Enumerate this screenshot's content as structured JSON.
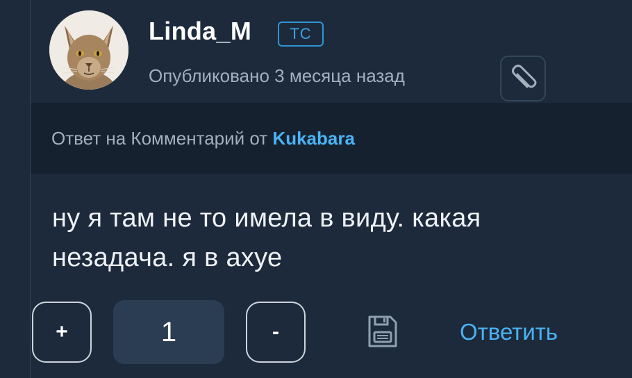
{
  "comment": {
    "username": "Linda_M",
    "badge": "ТС",
    "published": "Опубликовано 3 месяца назад",
    "reply_prefix": "Ответ на Комментарий от",
    "reply_author": "Kukabara",
    "text": "ну я там не то имела в виду. какая незадача. я в ахуе",
    "avatar_icon": "cat-avatar"
  },
  "actions": {
    "upvote_label": "+",
    "vote_count": "1",
    "downvote_label": "-",
    "save_icon": "floppy-disk-icon",
    "attach_icon": "paperclip-icon",
    "reply_label": "Ответить"
  },
  "colors": {
    "background": "#1d2a3b",
    "reply_bar": "#162130",
    "accent": "#4ab3f4",
    "muted_text": "#a3afbd"
  }
}
